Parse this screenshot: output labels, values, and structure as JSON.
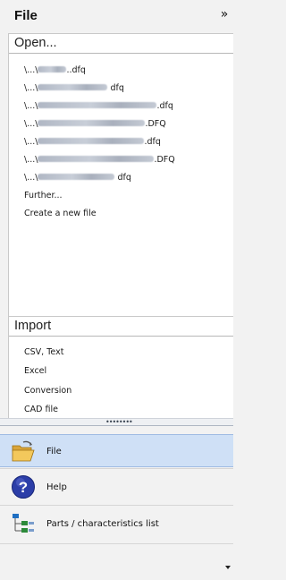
{
  "header": {
    "title": "File",
    "collapse_label": "»"
  },
  "open": {
    "title": "Open...",
    "recent_files": [
      {
        "prefix": "\\...\\",
        "suffix": "..dfq"
      },
      {
        "prefix": "\\...\\",
        "suffix": "dfq"
      },
      {
        "prefix": "\\...\\",
        "suffix": ".dfq"
      },
      {
        "prefix": "\\...\\",
        "suffix": ".DFQ"
      },
      {
        "prefix": "\\...\\",
        "suffix": ".dfq"
      },
      {
        "prefix": "\\...\\",
        "suffix": ".DFQ"
      },
      {
        "prefix": "\\...\\",
        "suffix": "dfq"
      }
    ],
    "further_label": "Further...",
    "create_label": "Create a new file"
  },
  "import": {
    "title": "Import",
    "items": [
      "CSV, Text",
      "Excel",
      "Conversion",
      "CAD file"
    ]
  },
  "nav": {
    "file_label": "File",
    "help_label": "Help",
    "parts_label": "Parts / characteristics list"
  },
  "colors": {
    "selected_bg": "#cfe0f6",
    "help_icon": "#2c3ea8",
    "folder": "#e8b84a"
  }
}
